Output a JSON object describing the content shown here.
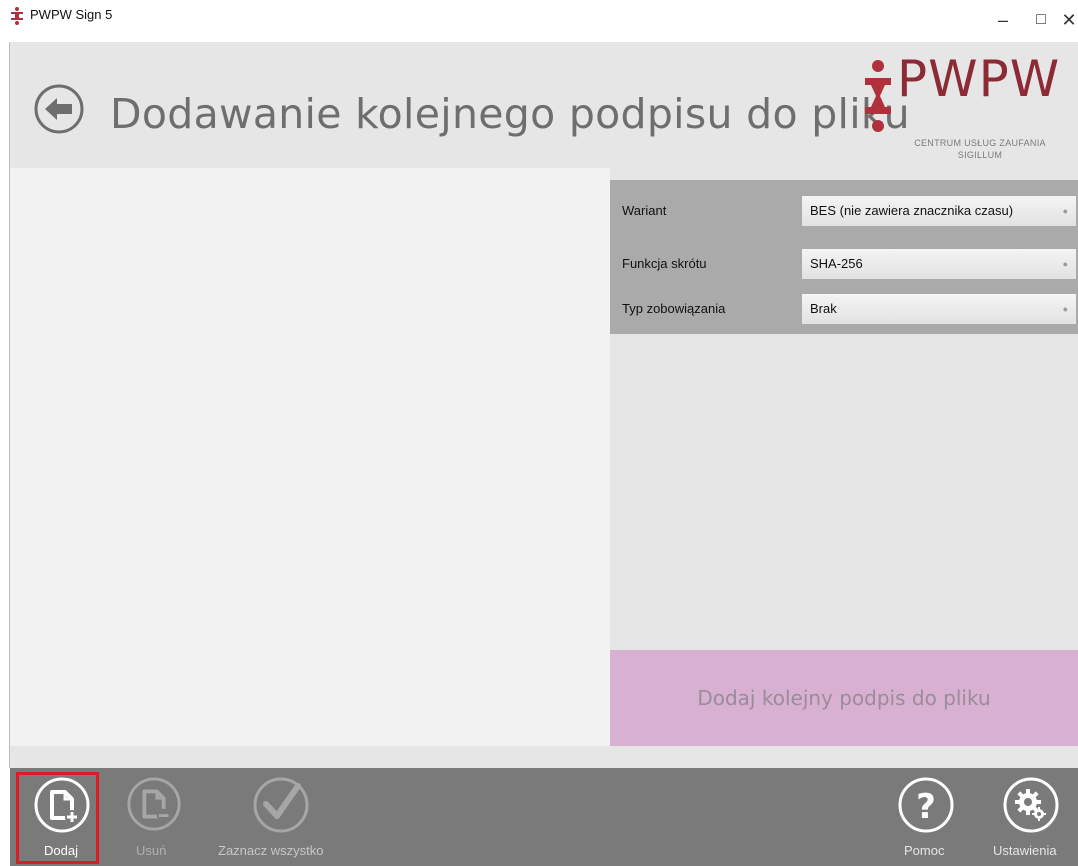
{
  "window": {
    "title": "PWPW Sign 5",
    "controls": {
      "minimize": "–",
      "maximize": "□",
      "close": "✕"
    }
  },
  "header": {
    "title": "Dodawanie kolejnego podpisu do pliku",
    "logo": {
      "word": "PWPW",
      "line1": "CENTRUM USŁUG ZAUFANIA",
      "line2": "SIGILLUM"
    }
  },
  "options": [
    {
      "label": "Wariant",
      "value": "BES (nie zawiera znacznika czasu)"
    },
    {
      "label": "Funkcja skrótu",
      "value": "SHA-256"
    },
    {
      "label": "Typ zobowiązania",
      "value": "Brak"
    }
  ],
  "sign_button": "Dodaj kolejny podpis do pliku",
  "toolbar": {
    "add": "Dodaj",
    "remove": "Usuń",
    "select_all": "Zaznacz wszystko",
    "help": "Pomoc",
    "settings": "Ustawienia"
  },
  "colors": {
    "brand": "#8c2b36",
    "sign_button_bg": "#d8b0d2",
    "toolbar_bg": "#7a7a7a",
    "highlight": "#e01b24"
  }
}
